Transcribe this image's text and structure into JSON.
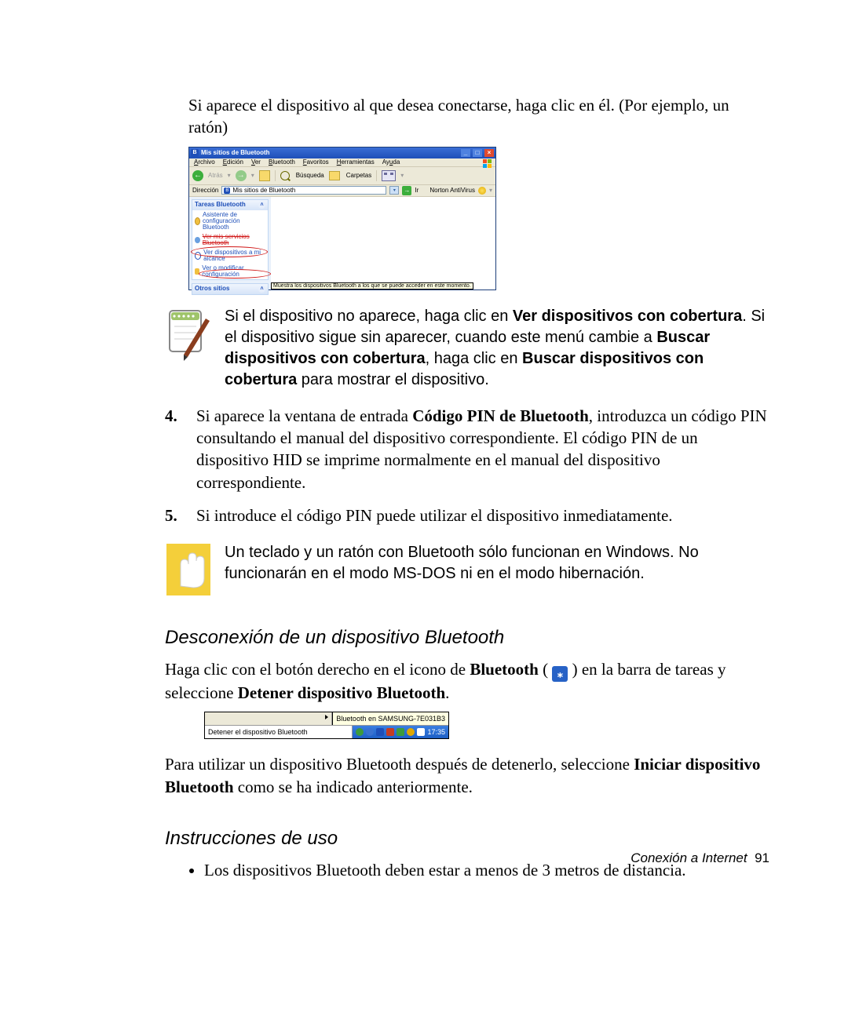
{
  "intro_para": "Si aparece el dispositivo al que desea conectarse, haga clic en él. (Por ejemplo, un ratón)",
  "bt_window": {
    "title": "Mis sitios de Bluetooth",
    "menus": {
      "archivo": "Archivo",
      "edicion": "Edición",
      "ver": "Ver",
      "bluetooth": "Bluetooth",
      "favoritos": "Favoritos",
      "herramientas": "Herramientas",
      "ayuda": "Ayuda"
    },
    "toolbar": {
      "atras": "Atrás",
      "busqueda": "Búsqueda",
      "carpetas": "Carpetas"
    },
    "address_label": "Dirección",
    "address_value": "Mis sitios de Bluetooth",
    "go": "Ir",
    "norton": "Norton AntiVirus",
    "side": {
      "tareas_hd": "Tareas Bluetooth",
      "task_asistente": "Asistente de configuración Bluetooth",
      "task_ver_servicios": "Ver mis servicios Bluetooth",
      "task_ver_alcance": "Ver dispositivos a mi alcance",
      "task_conf": "Ver o modificar configuración",
      "otros_hd": "Otros sitios"
    },
    "status_tip": "Muestra los dispositivos Bluetooth a los que se puede acceder en este momento."
  },
  "note1": {
    "pre_bold1": "Si el dispositivo no aparece, haga clic en ",
    "bold1": "Ver dispositivos con cobertura",
    "mid1": ". Si el dispositivo sigue sin aparecer, cuando este menú cambie a ",
    "bold2": "Buscar dispositivos con cobertura",
    "mid2": ", haga clic en ",
    "bold3": "Buscar dispositivos con cobertura",
    "tail": " para mostrar el dispositivo."
  },
  "step4": {
    "num": "4.",
    "pre": "Si aparece la ventana de entrada ",
    "bold": "Código PIN de Bluetooth",
    "tail": ", introduzca un código PIN consultando el manual del dispositivo correspondiente. El código PIN de un dispositivo HID se imprime normalmente en el manual del dispositivo correspondiente."
  },
  "step5": {
    "num": "5.",
    "text": "Si introduce el código PIN puede utilizar el dispositivo inmediatamente."
  },
  "note2": "Un teclado y un ratón con Bluetooth sólo funcionan en Windows. No funcionarán en el modo MS-DOS ni en el modo hibernación.",
  "h_desconexion": "Desconexión de un dispositivo Bluetooth",
  "desc_para": {
    "pre": "Haga clic con el botón derecho en el icono de ",
    "bold1": "Bluetooth",
    "mid": " ( ",
    "close": " ) en la barra de tareas y seleccione ",
    "bold2": "Detener dispositivo Bluetooth",
    "period": "."
  },
  "taskbar": {
    "top_grey": "",
    "tooltip": "Bluetooth en SAMSUNG-7E031B3",
    "stop_item": "Detener el dispositivo Bluetooth",
    "clock": "17:35"
  },
  "after_taskbar": {
    "pre": "Para utilizar un dispositivo Bluetooth después de detenerlo, seleccione ",
    "bold": "Iniciar dispositivo Bluetooth",
    "tail": " como se ha indicado anteriormente."
  },
  "h_instrucciones": "Instrucciones de uso",
  "bullet1": "Los dispositivos Bluetooth deben estar a menos de 3 metros de distancia.",
  "footer": {
    "label": "Conexión a Internet",
    "page": "91"
  },
  "icons": {
    "bt_glyph": "⁎"
  }
}
